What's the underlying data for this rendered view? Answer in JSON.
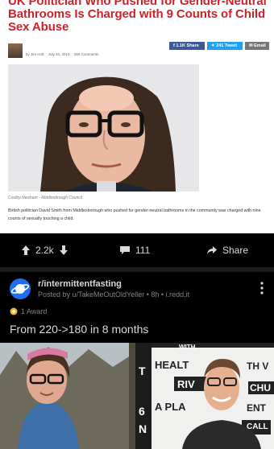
{
  "article": {
    "headline": "UK Politician Who Pushed for Gender-Neutral Bathrooms Is Charged with 9 Counts of Child Sex Abuse",
    "byline": {
      "author": "by Jim Hoft",
      "date": "July 20, 2019",
      "comments": "260 Comments"
    },
    "share": {
      "facebook": "1.1K Share",
      "twitter": "241 Tweet",
      "email": "Email"
    },
    "photo_caption": "Coulby Newham - Middlesbrough Council",
    "body": "British politician David Smith from Middlesborough who pushed for gender-neutral bathrooms in the community was charged with nine counts of sexually touching a child."
  },
  "actions": {
    "score": "2.2k",
    "comments": "111",
    "share": "Share"
  },
  "post": {
    "subreddit": "r/intermittentfasting",
    "posted_by": "Posted by u/TakeMeOutOldYeller",
    "meta_tail": "• 8h • i.redd.it",
    "awards": "1 Award",
    "title": "From 220->180 in 8 months",
    "sign_text": [
      "WITH",
      "HEALT",
      "RIV",
      "A PLA",
      "TH V",
      "CHU",
      "ENT",
      "CALL"
    ]
  },
  "colors": {
    "headline": "#cc2229",
    "reddit_text": "#d7dadc",
    "reddit_meta": "#818384",
    "subreddit_icon": "#1e6ef0",
    "award": "#f2b233"
  }
}
